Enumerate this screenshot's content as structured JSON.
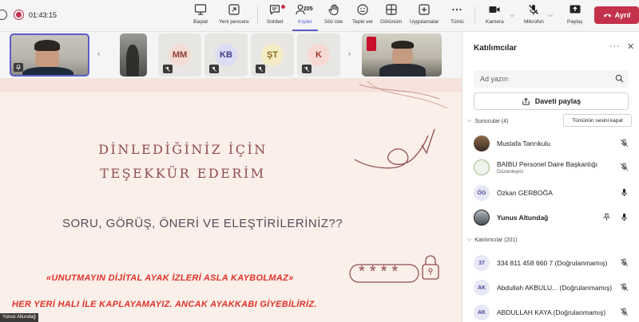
{
  "meeting": {
    "timer": "01:43:15"
  },
  "toolbar": {
    "start_label": "Başlat",
    "new_window_label": "Yeni pencere",
    "chat_label": "Sohbet",
    "people_label": "Kişiler",
    "people_count": "205",
    "raise_hand_label": "Söz iste",
    "react_label": "Tepki ver",
    "view_label": "Görünüm",
    "apps_label": "Uygulamalar",
    "more_label": "Tümü",
    "camera_label": "Kamera",
    "mic_label": "Mikrofon",
    "share_label": "Paylaş",
    "leave_label": "Ayrıl"
  },
  "strip": {
    "avatars": [
      {
        "initials": "MM",
        "bg": "#f4dcd6",
        "fg": "#8a3b2e"
      },
      {
        "initials": "KB",
        "bg": "#dcdcf2",
        "fg": "#3b3b8a"
      },
      {
        "initials": "ŞT",
        "bg": "#f4ecc4",
        "fg": "#8a6a1e"
      },
      {
        "initials": "K",
        "bg": "#f6d9d2",
        "fg": "#a33c2c"
      }
    ]
  },
  "slide": {
    "title_line1": "DİNLEDİĞİNİZ İÇİN",
    "title_line2": "TEŞEKKÜR EDERİM",
    "question": "SORU, GÖRÜŞ, ÖNERİ VE ELEŞTİRİLERİNİZ??",
    "warning": "«UNUTMAYIN DİJİTAL AYAK İZLERİ ASLA KAYBOLMAZ»",
    "proverb": "HER YERİ HALI İLE KAPLAYAMAYIZ. ANCAK AYAKKABI GİYEBİLİRİZ.",
    "password_mask": "****",
    "presenter_tag": "Yunus Altundağ"
  },
  "panel": {
    "title": "Katılımcılar",
    "search_placeholder": "Ad yazın",
    "share_invite_label": "Daveti paylaş",
    "presenters_header": "Sunucular (4)",
    "mute_all_label": "Tümünün sesini kapat",
    "attendees_header": "Katılımcılar (201)",
    "presenters": [
      {
        "name": "Mustafa Tanrıkulu",
        "subtitle": ""
      },
      {
        "name": "BAİBU Personel Daire Başkanlığı",
        "subtitle": "Düzenleyici"
      },
      {
        "name": "Özkan GERBOĞA",
        "subtitle": "",
        "initials": "ÖG"
      },
      {
        "name": "Yunus Altundağ",
        "subtitle": ""
      }
    ],
    "attendees": [
      {
        "name": "334 811 458 660 7 (Doğrulanmamış)",
        "initials": "37"
      },
      {
        "name": "Abdullah AKBULU... (Doğrulanmamış)",
        "initials": "AK"
      },
      {
        "name": "ABDULLAH KAYA (Doğrulanmamış)",
        "initials": "AK"
      }
    ]
  },
  "colors": {
    "accent": "#5b5fc7",
    "leave": "#c4314b",
    "slide_title": "#8d4d4f",
    "slide_warning": "#e0322b"
  }
}
